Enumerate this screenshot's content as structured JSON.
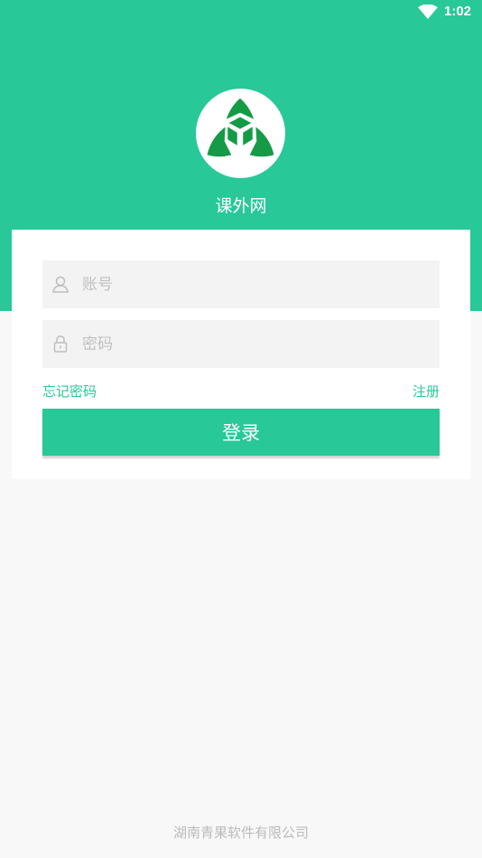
{
  "status_bar": {
    "time": "1:02",
    "wifi_icon": "wifi-icon"
  },
  "header": {
    "app_name": "课外网",
    "logo_icon": "three-petal-logo-icon"
  },
  "form": {
    "account_placeholder": "账号",
    "account_icon": "user-icon",
    "password_placeholder": "密码",
    "password_icon": "lock-icon",
    "forgot_label": "忘记密码",
    "register_label": "注册",
    "login_label": "登录"
  },
  "footer": {
    "company": "湖南青果软件有限公司"
  },
  "colors": {
    "accent": "#28c899",
    "logo_green": "#159b45",
    "background": "#f8f8f8"
  }
}
